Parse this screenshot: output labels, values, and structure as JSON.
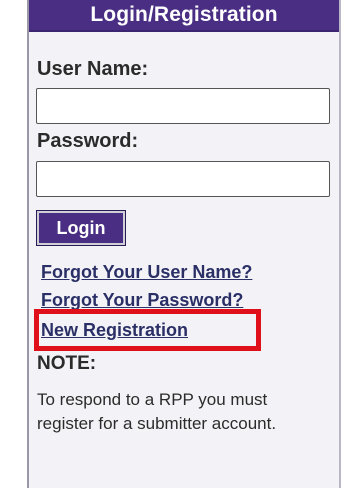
{
  "panel": {
    "title": "Login/Registration"
  },
  "form": {
    "username_label": "User Name:",
    "username_value": "",
    "password_label": "Password:",
    "password_value": "",
    "login_button": "Login"
  },
  "links": {
    "forgot_username": "Forgot Your User Name?",
    "forgot_password": "Forgot Your Password?",
    "new_registration": "New Registration"
  },
  "note": {
    "label": "NOTE:",
    "text": "To respond to a RPP you must register for a submitter account."
  },
  "colors": {
    "header_bg": "#4a2e84",
    "link": "#2a2f66",
    "highlight": "#e0101a"
  }
}
